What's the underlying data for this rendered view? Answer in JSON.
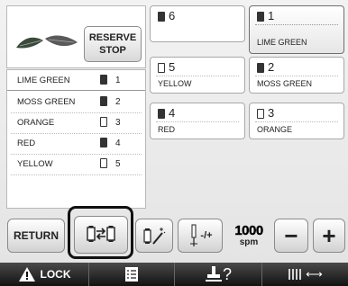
{
  "preview": {
    "reserve_stop_line1": "RESERVE",
    "reserve_stop_line2": "STOP"
  },
  "color_list": [
    {
      "name": "LIME GREEN",
      "needle": "1",
      "spool": "dark"
    },
    {
      "name": "MOSS GREEN",
      "needle": "2",
      "spool": "dark"
    },
    {
      "name": "ORANGE",
      "needle": "3",
      "spool": "light"
    },
    {
      "name": "RED",
      "needle": "4",
      "spool": "dark"
    },
    {
      "name": "YELLOW",
      "needle": "5",
      "spool": "light"
    }
  ],
  "needles": [
    {
      "number": "6",
      "color": "",
      "spool": "dark"
    },
    {
      "number": "1",
      "color": "LIME GREEN",
      "spool": "dark"
    },
    {
      "number": "5",
      "color": "YELLOW",
      "spool": "light"
    },
    {
      "number": "2",
      "color": "MOSS GREEN",
      "spool": "dark"
    },
    {
      "number": "4",
      "color": "RED",
      "spool": "dark"
    },
    {
      "number": "3",
      "color": "ORANGE",
      "spool": "light"
    }
  ],
  "buttons": {
    "return_label": "RETURN",
    "speed_adjust_label": "-/+",
    "minus_label": "−",
    "plus_label": "+"
  },
  "speed": {
    "value": "1000",
    "unit": "spm"
  },
  "bottom_bar": {
    "lock_label": "LOCK",
    "presser_label": "?",
    "thread_label": "⟷"
  },
  "icons": {
    "swap": "needle-swap-icon",
    "wand": "magic-wand-icon",
    "speed": "needle-speed-icon",
    "warning": "warning-triangle-icon",
    "list": "list-icon",
    "presser": "presser-foot-icon",
    "thread": "needles-arrow-icon"
  }
}
